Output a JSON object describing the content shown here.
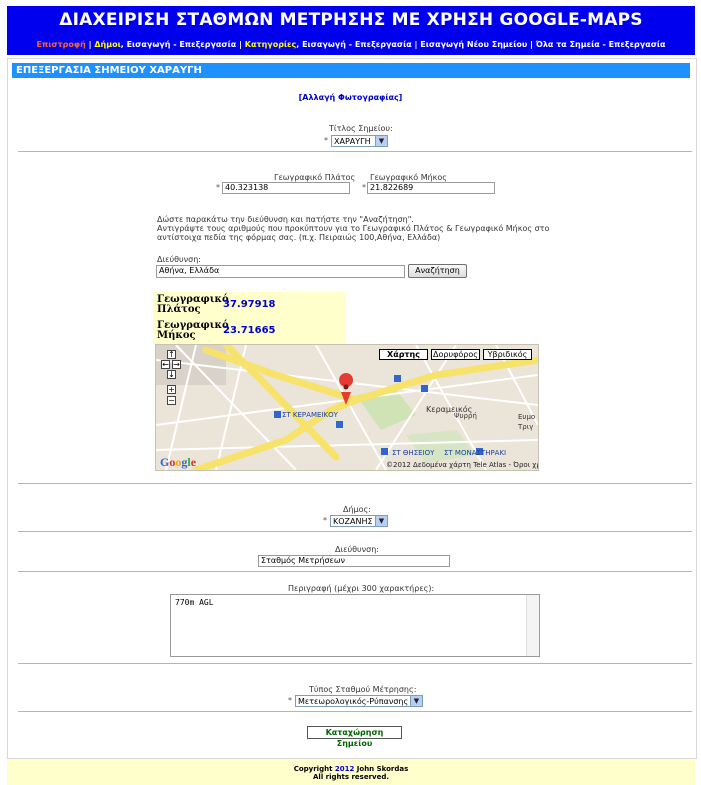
{
  "header": {
    "title": "ΔΙΑΧΕΙΡΙΣΗ ΣΤΑΘΜΩΝ ΜΕΤΡΗΣΗΣ ΜΕ ΧΡΗΣΗ GOOGLE-MAPS",
    "nav": [
      {
        "label": "Επιστροφή",
        "color": "red"
      },
      {
        "label": " | ",
        "color": "white"
      },
      {
        "label": "Δήμοι",
        "color": "yellow"
      },
      {
        "label": ", Εισαγωγή - Επεξεργασία | ",
        "color": "white"
      },
      {
        "label": "Κατηγορίες",
        "color": "yellow"
      },
      {
        "label": ", Εισαγωγή - Επεξεργασία | Εισαγωγή Νέου Σημείου | Όλα τα Σημεία - Επεξεργασία",
        "color": "white"
      }
    ]
  },
  "section_title": "ΕΠΕΞΕΡΓΑΣΙΑ ΣΗΜΕΙΟΥ ΧΑΡΑΥΓΗ",
  "photo_link": "[Αλλαγή Φωτογραφίας]",
  "point_title": {
    "label": "Τίτλος Σημείου:",
    "value": "ΧΑΡΑΥΓΗ",
    "required": "*"
  },
  "latitude": {
    "label": "Γεωγραφικό Πλάτος",
    "value": "40.323138",
    "required": "*"
  },
  "longitude": {
    "label": "Γεωγραφικό Μήκος",
    "value": "21.822689",
    "required": "*"
  },
  "instructions": [
    "Δώστε παρακάτω την διεύθυνση και πατήστε την \"Αναζήτηση\".",
    "Αντιγράψτε τους αριθμούς που προκύπτουν για το Γεωγραφικό Πλάτος & Γεωγραφικό Μήκος στο αντίστοιχα πεδία της φόρμας σας. (π.χ. Πειραιώς 100,Αθήνα, Ελλάδα)"
  ],
  "geocode": {
    "label": "Διεύθυνση:",
    "value": "Αθήνα, Ελλάδα",
    "button": "Αναζήτηση",
    "lat_label_1": "Γεωγραφικό",
    "lat_label_2": "Πλάτος",
    "lat_value": "37.97918",
    "lng_label_1": "Γεωγραφικό",
    "lng_label_2": "Μήκος",
    "lng_value": "23.71665"
  },
  "map": {
    "buttons": [
      "Χάρτης",
      "Δορυφόρος",
      "Υβριδικός"
    ],
    "labels": [
      "Κεραμεικός",
      "ΣΤ ΚΕΡΑΜΕΙΚΟΥ",
      "Ψυρρή",
      "ΣΤ ΘΗΣΕΙΟΥ",
      "ΣΤ ΜΟΝΑΣΤΗΡΑΚΙ",
      "Ευμο",
      "Τριγ"
    ],
    "copyright": "©2012 Δεδομένα χάρτη Tele Atlas - Όροι χρήσης",
    "logo": "Google"
  },
  "municipality": {
    "label": "Δήμος:",
    "value": "ΚΟΖΑΝΗΣ",
    "required": "*"
  },
  "address": {
    "label": "Διεύθυνση:",
    "value": "Σταθμός Μετρήσεων"
  },
  "description": {
    "label": "Περιγραφή (μέχρι 300 χαρακτήρες):",
    "value": "770m AGL"
  },
  "station_type": {
    "label": "Τύπος Σταθμού Μέτρησης:",
    "value": "Μετεωρολογικός-Ρύπανσης",
    "required": "*"
  },
  "submit_label": "Καταχώρηση Σημείου",
  "footer": {
    "line1_prefix": "Copyright ",
    "year": "2012",
    "line1_suffix": " John Skordas",
    "line2": "All rights reserved."
  },
  "colors": {
    "header_bg": "#0000ee",
    "section_bar": "#1e90ff",
    "footer_bg": "#ffffcc",
    "link": "#0000cc",
    "submit_text": "#006600"
  }
}
